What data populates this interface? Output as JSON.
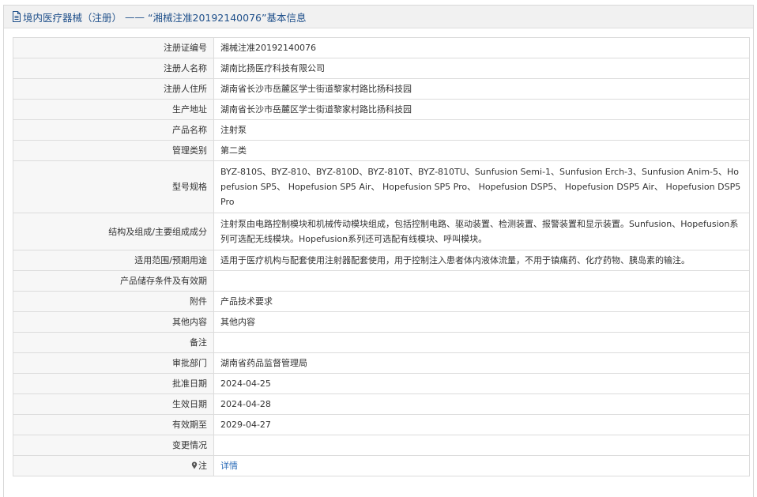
{
  "header": {
    "title_prefix": "境内医疗器械（注册）",
    "separator": "——",
    "title_suffix": "“湘械注准20192140076”基本信息",
    "icon": "document-icon",
    "accent_color": "#1e4f8a"
  },
  "rows": [
    {
      "label": "注册证编号",
      "value": "湘械注准20192140076"
    },
    {
      "label": "注册人名称",
      "value": "湖南比扬医疗科技有限公司"
    },
    {
      "label": "注册人住所",
      "value": "湖南省长沙市岳麓区学士街道黎家村路比扬科技园"
    },
    {
      "label": "生产地址",
      "value": "湖南省长沙市岳麓区学士街道黎家村路比扬科技园"
    },
    {
      "label": "产品名称",
      "value": "注射泵"
    },
    {
      "label": "管理类别",
      "value": "第二类"
    },
    {
      "label": "型号规格",
      "value": "BYZ-810S、BYZ-810、BYZ-810D、BYZ-810T、BYZ-810TU、Sunfusion Semi-1、Sunfusion Erch-3、Sunfusion Anim-5、Hopefusion SP5、 Hopefusion SP5 Air、 Hopefusion SP5 Pro、 Hopefusion DSP5、 Hopefusion DSP5 Air、 Hopefusion DSP5 Pro"
    },
    {
      "label": "结构及组成/主要组成成分",
      "value": "注射泵由电路控制模块和机械传动模块组成，包括控制电路、驱动装置、检测装置、报警装置和显示装置。Sunfusion、Hopefusion系列可选配无线模块。Hopefusion系列还可选配有线模块、呼叫模块。"
    },
    {
      "label": "适用范围/预期用途",
      "value": "适用于医疗机构与配套使用注射器配套使用，用于控制注入患者体内液体流量，不用于镇痛药、化疗药物、胰岛素的输注。"
    },
    {
      "label": "产品储存条件及有效期",
      "value": ""
    },
    {
      "label": "附件",
      "value": "产品技术要求"
    },
    {
      "label": "其他内容",
      "value": "其他内容"
    },
    {
      "label": "备注",
      "value": ""
    },
    {
      "label": "审批部门",
      "value": "湖南省药品监督管理局"
    },
    {
      "label": "批准日期",
      "value": "2024-04-25"
    },
    {
      "label": "生效日期",
      "value": "2024-04-28"
    },
    {
      "label": "有效期至",
      "value": "2029-04-27"
    },
    {
      "label": "变更情况",
      "value": ""
    }
  ],
  "note": {
    "label": "注",
    "icon": "pin-icon",
    "link_text": "详情",
    "link_color": "#2b6cb8"
  }
}
